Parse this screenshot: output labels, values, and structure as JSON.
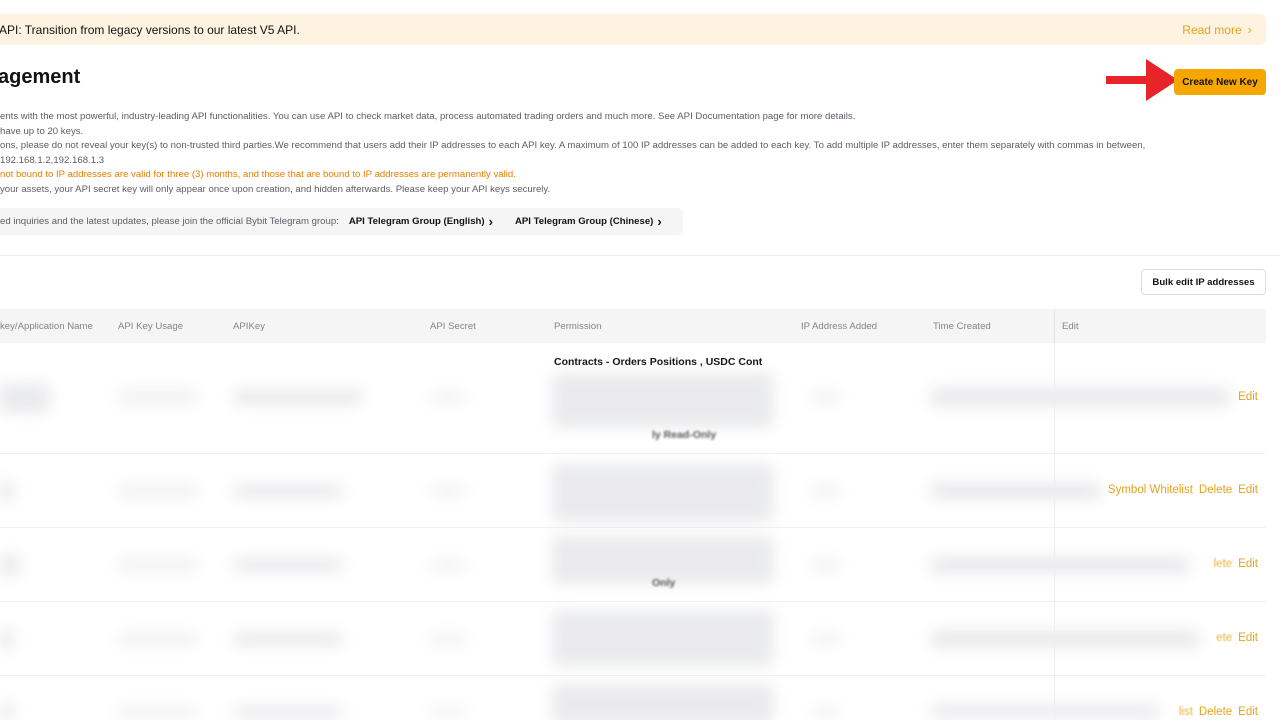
{
  "banner": {
    "message": "API: Transition from legacy versions to our latest V5 API.",
    "read_more": "Read more"
  },
  "page": {
    "title": "agement",
    "create_button": "Create New Key",
    "bulk_button": "Bulk edit IP addresses"
  },
  "description": {
    "lines": [
      "ents with the most powerful, industry-leading API functionalities. You can use API to check market data, process automated trading orders and much more. See API Documentation page for more details.",
      "have up to 20 keys.",
      "ons, please do not reveal your key(s) to non-trusted third parties.We recommend that users add their IP addresses to each API key. A maximum of 100 IP addresses can be added to each key. To add multiple IP addresses, enter them separately with commas in between,",
      "192.168.1.2,192.168.1.3",
      "not bound to IP addresses are valid for three (3) months, and those that are bound to IP addresses are permanently valid.",
      "your assets, your API secret key will only appear once upon creation, and hidden afterwards. Please keep your API keys securely."
    ]
  },
  "telegram": {
    "text": "ed inquiries and the latest updates, please join the official Bybit Telegram group:",
    "english": "API Telegram Group (English)",
    "chinese": "API Telegram Group (Chinese)"
  },
  "table": {
    "headers": [
      "key/Application Name",
      "API Key Usage",
      "APIKey",
      "API Secret",
      "Permission",
      "IP Address Added",
      "Time Created",
      "Edit"
    ],
    "row1": {
      "permission_top": "Contracts - Orders Positions , USDC Cont",
      "permission_bottom": "ly Read-Only",
      "actions": [
        "Edit"
      ]
    },
    "row2": {
      "actions": [
        "Symbol Whitelist",
        "Delete",
        "Edit"
      ]
    },
    "row3": {
      "permission_bottom": "Only",
      "actions": [
        "lete",
        "Edit"
      ]
    },
    "row4": {
      "actions": [
        "ete",
        "Edit"
      ]
    },
    "row5": {
      "actions": [
        "list",
        "Delete",
        "Edit"
      ]
    }
  },
  "colors": {
    "accent": "#f7a600",
    "link": "#e6a21a",
    "warning": "#e67e00",
    "annotation_arrow": "#e8232a"
  }
}
